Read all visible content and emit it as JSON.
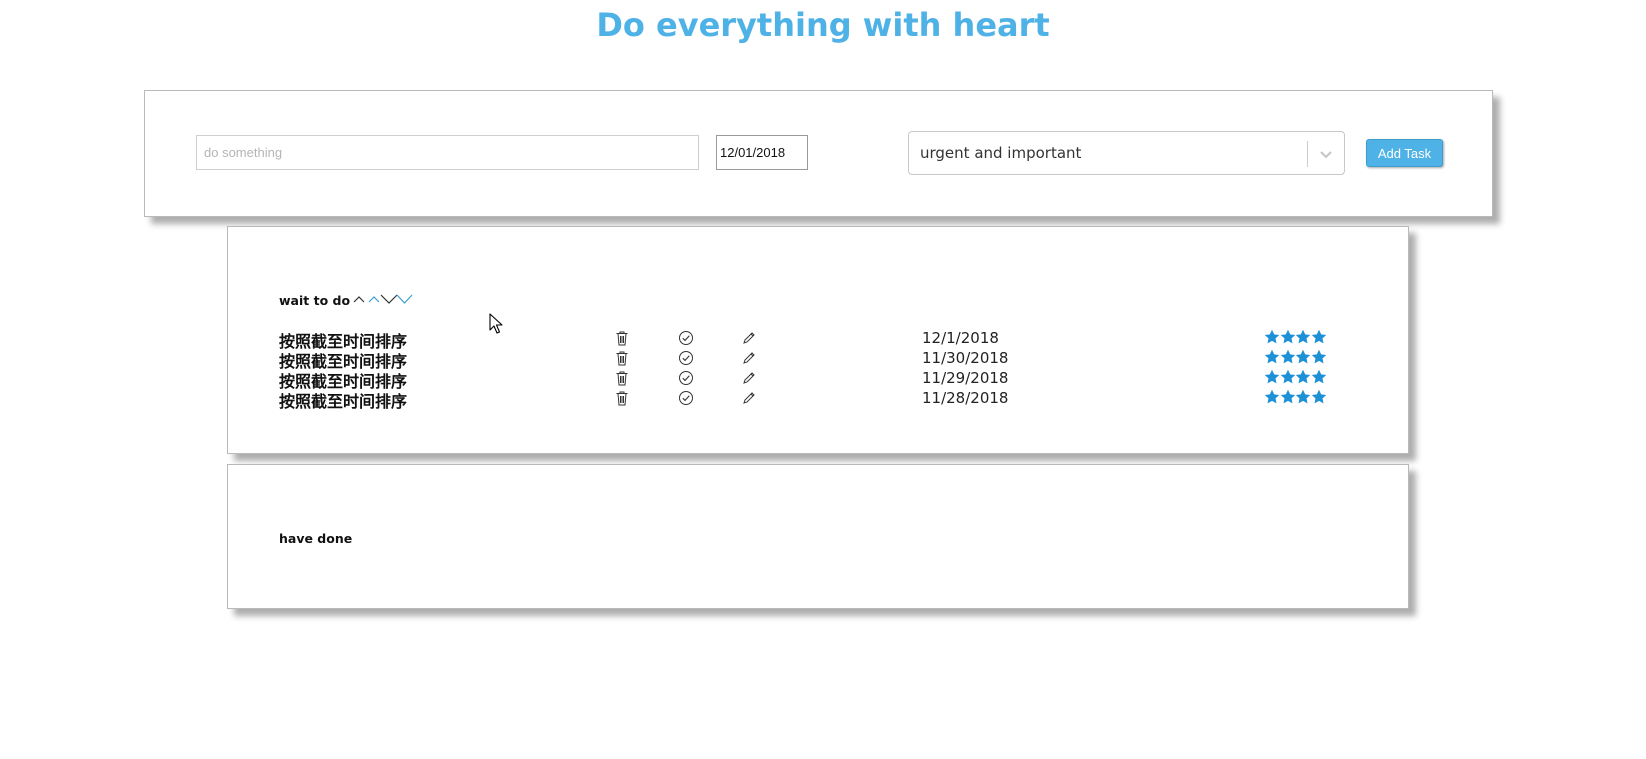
{
  "header": {
    "title": "Do everything with heart"
  },
  "add_form": {
    "task_placeholder": "do something",
    "task_value": "",
    "date_value": "12/01/2018",
    "priority_selected": "urgent and important",
    "add_button_label": "Add Task"
  },
  "todo": {
    "title": "wait to do",
    "tasks": [
      {
        "name": "按照截至时间排序",
        "date": "12/1/2018",
        "stars": 4
      },
      {
        "name": "按照截至时间排序",
        "date": "11/30/2018",
        "stars": 4
      },
      {
        "name": "按照截至时间排序",
        "date": "11/29/2018",
        "stars": 4
      },
      {
        "name": "按照截至时间排序",
        "date": "11/28/2018",
        "stars": 4
      }
    ]
  },
  "done": {
    "title": "have done"
  },
  "colors": {
    "accent": "#4fb2e6",
    "star": "#1e90d6",
    "sort_icon": "#3d9ed0"
  },
  "icons": [
    "trash-icon",
    "check-circle-icon",
    "pencil-icon",
    "star-icon",
    "chevron-up-icon",
    "chevron-down-icon",
    "cursor-icon"
  ]
}
